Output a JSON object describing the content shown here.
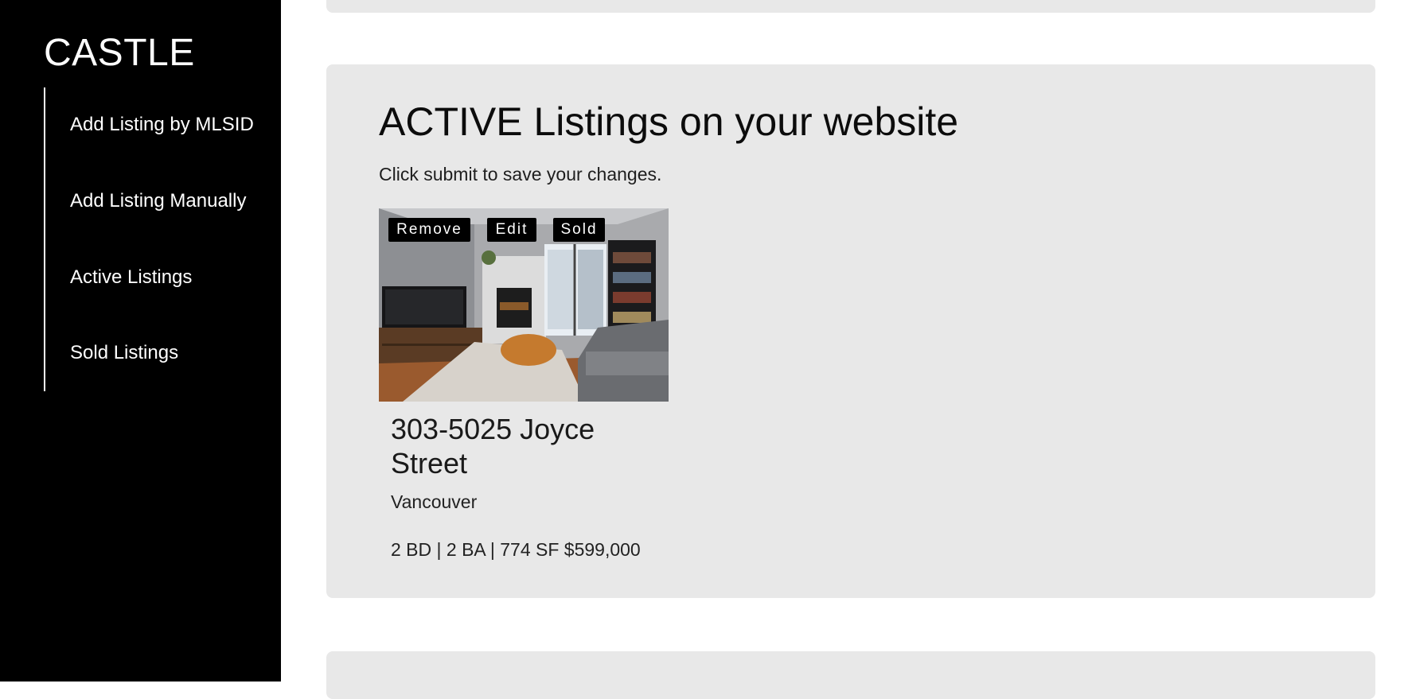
{
  "sidebar": {
    "brand": "CASTLE",
    "items": [
      {
        "label": "Add Listing by MLSID"
      },
      {
        "label": "Add Listing Manually"
      },
      {
        "label": "Active Listings"
      },
      {
        "label": "Sold Listings"
      }
    ]
  },
  "main": {
    "active_panel": {
      "title": "ACTIVE Listings on your website",
      "subtitle": "Click submit to save your changes.",
      "listings": [
        {
          "photo_icon": "living-room-photo",
          "actions": {
            "remove_label": "Remove",
            "edit_label": "Edit",
            "sold_label": "Sold"
          },
          "address": "303-5025 Joyce Street",
          "city": "Vancouver",
          "specs": "2 BD | 2 BA | 774 SF $599,000"
        }
      ]
    }
  },
  "colors": {
    "sidebar_bg": "#000000",
    "panel_bg": "#e8e8e8",
    "button_bg": "#000000",
    "button_text": "#ffffff"
  }
}
